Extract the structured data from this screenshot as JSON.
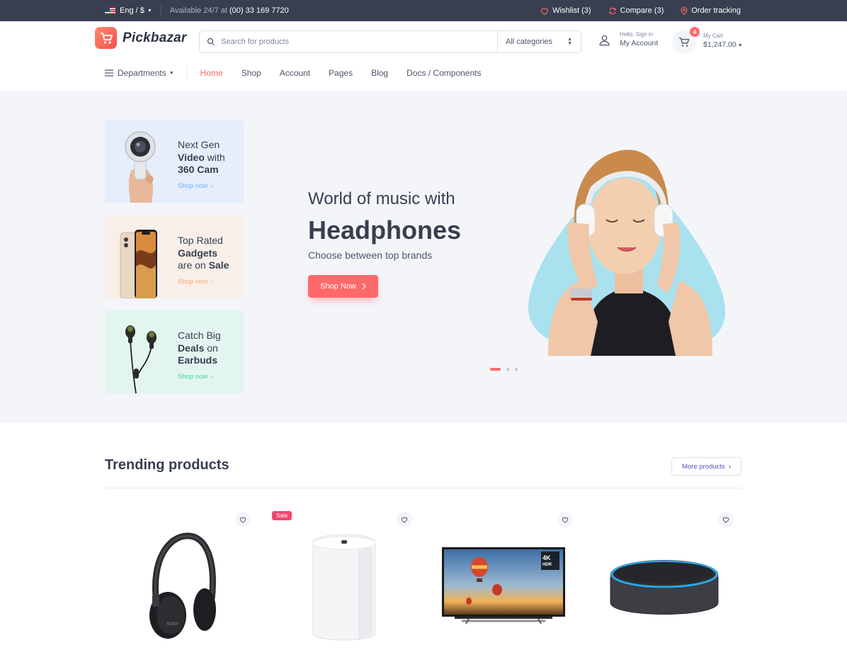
{
  "topbar": {
    "language": "Eng / $",
    "availability_prefix": "Available 24/7 at",
    "phone": "(00) 33 169 7720",
    "wishlist": "Wishlist (3)",
    "compare": "Compare (3)",
    "order_tracking": "Order tracking"
  },
  "header": {
    "logo_text": "Pickbazar",
    "search_placeholder": "Search for products",
    "category_select": "All categories",
    "account_greeting": "Hello, Sign in",
    "account_label": "My Account",
    "cart_label": "My Cart",
    "cart_total": "$1,247.00",
    "cart_count": "4"
  },
  "nav": {
    "departments": "Departments",
    "items": [
      "Home",
      "Shop",
      "Account",
      "Pages",
      "Blog",
      "Docs / Components"
    ],
    "active": "Home"
  },
  "promos": [
    {
      "line1": "Next Gen",
      "line2_bold": "Video",
      "line2_rest": " with",
      "line3_bold": "360 Cam",
      "link": "Shop now"
    },
    {
      "line1": "Top Rated",
      "line2_bold": "Gadgets",
      "line3_pre": "are on ",
      "line3_bold": "Sale",
      "link": "Shop now"
    },
    {
      "line1": "Catch Big",
      "line2_bold": "Deals",
      "line2_rest": " on",
      "line3_bold": "Earbuds",
      "link": "Shop now"
    }
  ],
  "hero": {
    "subtitle": "World of music with",
    "title": "Headphones",
    "description": "Choose between top brands",
    "button": "Shop Now"
  },
  "trending": {
    "title": "Trending products",
    "more_button": "More products",
    "sale_badge": "Sale",
    "products": [
      "headphones",
      "router",
      "tv",
      "smart-speaker"
    ]
  },
  "colors": {
    "accent": "#fe696a",
    "topbar_bg": "#373f50",
    "hero_bg": "#f3f5f9"
  }
}
